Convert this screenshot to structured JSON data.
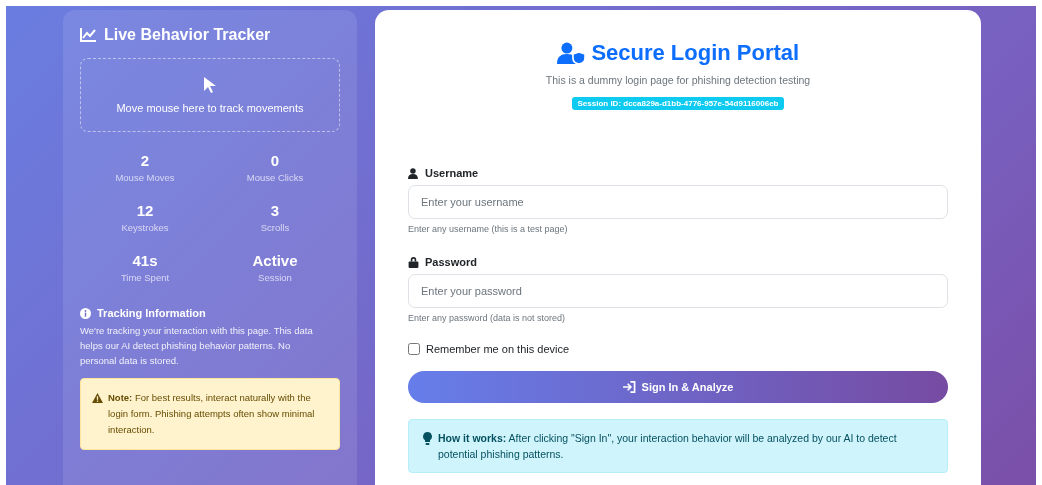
{
  "tracker": {
    "title": "Live Behavior Tracker",
    "mouse_area": {
      "hint": "Move mouse here to track movements"
    },
    "stats": [
      {
        "value": "2",
        "label": "Mouse Moves"
      },
      {
        "value": "0",
        "label": "Mouse Clicks"
      },
      {
        "value": "12",
        "label": "Keystrokes"
      },
      {
        "value": "3",
        "label": "Scrolls"
      },
      {
        "value": "41s",
        "label": "Time Spent"
      },
      {
        "value": "Active",
        "label": "Session"
      }
    ],
    "info": {
      "title": "Tracking Information",
      "text": "We're tracking your interaction with this page. This data helps our AI detect phishing behavior patterns. No personal data is stored."
    },
    "note": "**Note:** For best results, interact naturally with the login form. Phishing attempts often show minimal interaction."
  },
  "login": {
    "title": "Secure Login Portal",
    "subtitle": "This is a dummy login page for phishing detection testing",
    "session_badge": "Session ID: dcca829a-d1bb-4776-957e-54d9116006eb",
    "fields": [
      {
        "kind": "user",
        "label": "Username",
        "placeholder": "Enter your username",
        "help": "Enter any username (this is a test page)"
      },
      {
        "kind": "lock",
        "label": "Password",
        "placeholder": "Enter your password",
        "help": "Enter any password (data is not stored)"
      }
    ],
    "remember": {
      "label": "Remember me on this device",
      "checked": false
    },
    "submit": "Sign In & Analyze",
    "how_it_works": "**How it works:** After clicking \"Sign In\", your interaction behavior will be analyzed by our AI to detect potential phishing patterns."
  }
}
